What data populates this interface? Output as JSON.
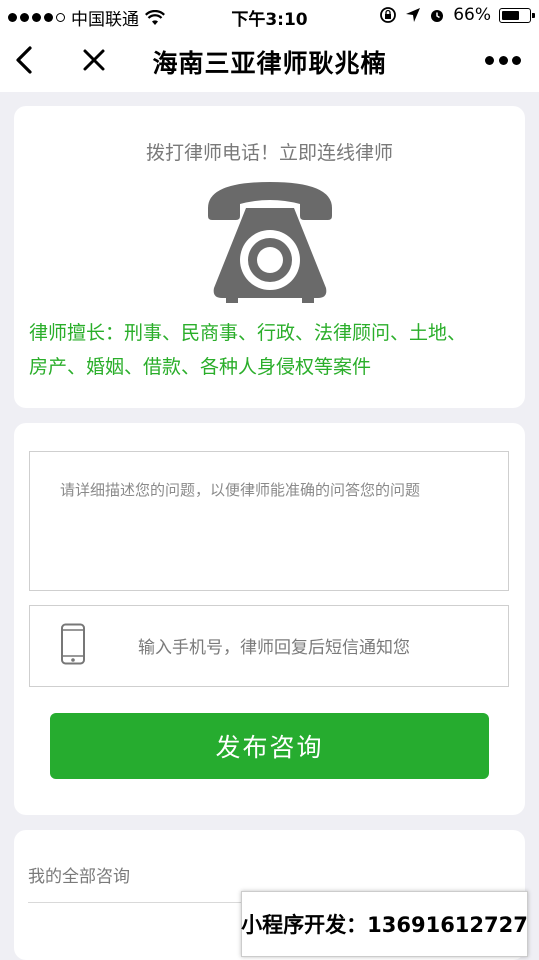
{
  "status_bar": {
    "carrier": "中国联通",
    "time": "下午3:10",
    "battery": "66%",
    "battery_level": 0.66
  },
  "nav": {
    "title": "海南三亚律师耿兆楠"
  },
  "call_card": {
    "heading": "拨打律师电话！立即连线律师",
    "specialty_line1": "律师擅长：刑事、民商事、行政、法律顾问、土地、",
    "specialty_line2": "房产、婚姻、借款、各种人身侵权等案件"
  },
  "form": {
    "question_placeholder": "请详细描述您的问题，以便律师能准确的问答您的问题",
    "phone_placeholder": "输入手机号，律师回复后短信通知您",
    "submit_label": "发布咨询"
  },
  "consult": {
    "label": "我的全部咨询"
  },
  "dev_banner": {
    "text": "小程序开发：13691612727"
  },
  "colors": {
    "accent_green": "#26ac2f",
    "specialty_green": "#2aae2a",
    "background": "#efeff4"
  }
}
